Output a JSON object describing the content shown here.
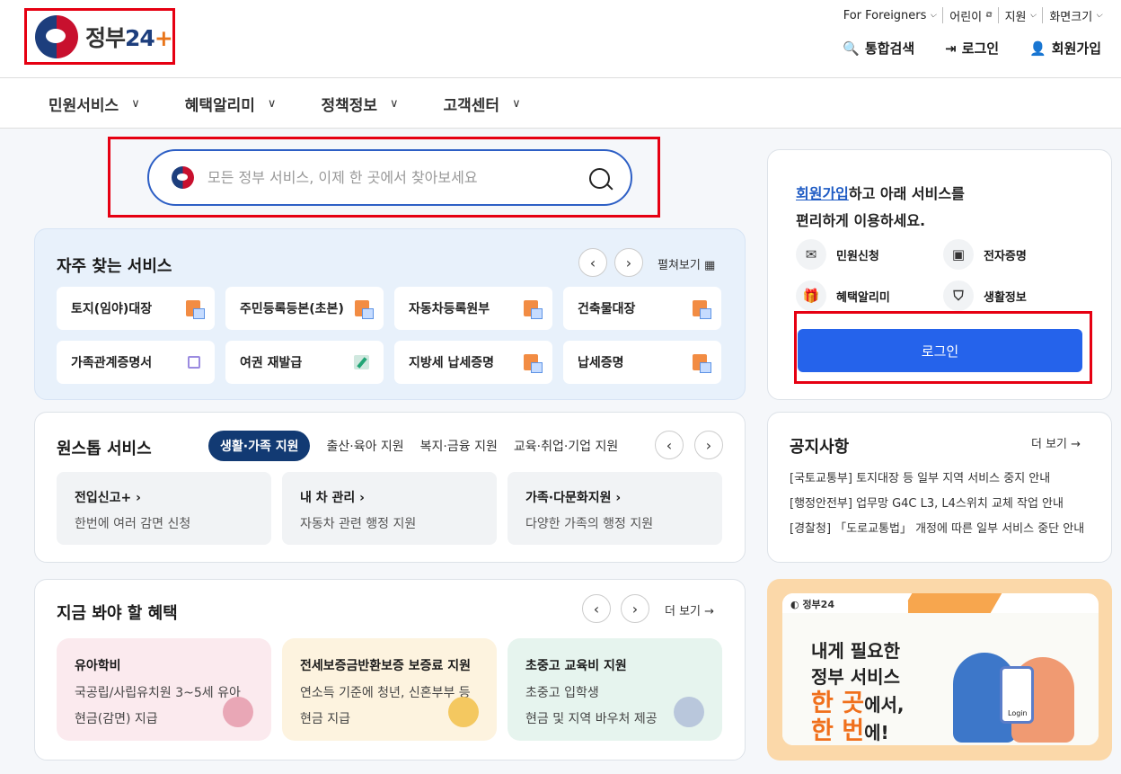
{
  "header": {
    "logo": {
      "text": "정부",
      "number": "24",
      "plus": "+"
    },
    "utility": {
      "foreigners": "For Foreigners",
      "kids": "어린이",
      "support": "지원",
      "screen_size": "화면크기"
    },
    "actions": {
      "search": "통합검색",
      "login": "로그인",
      "signup": "회원가입"
    }
  },
  "nav": {
    "items": [
      {
        "label": "민원서비스"
      },
      {
        "label": "혜택알리미"
      },
      {
        "label": "정책정보"
      },
      {
        "label": "고객센터"
      }
    ]
  },
  "search": {
    "placeholder": "모든 정부 서비스, 이제 한 곳에서 찾아보세요"
  },
  "frequent": {
    "title": "자주 찾는 서비스",
    "expand_label": "펼쳐보기",
    "items": [
      {
        "label": "토지(임야)대장",
        "icon": "document-icon"
      },
      {
        "label": "주민등록등본(초본)",
        "icon": "document-icon"
      },
      {
        "label": "자동차등록원부",
        "icon": "document-icon"
      },
      {
        "label": "건축물대장",
        "icon": "document-icon"
      },
      {
        "label": "가족관계증명서",
        "icon": "external-link-icon"
      },
      {
        "label": "여권 재발급",
        "icon": "edit-icon"
      },
      {
        "label": "지방세 납세증명",
        "icon": "document-icon"
      },
      {
        "label": "납세증명",
        "icon": "document-icon"
      }
    ]
  },
  "onestop": {
    "title": "원스톱 서비스",
    "tabs": [
      {
        "label": "생활·가족 지원",
        "active": true
      },
      {
        "label": "출산·육아 지원"
      },
      {
        "label": "복지·금융 지원"
      },
      {
        "label": "교육·취업·기업 지원"
      }
    ],
    "items": [
      {
        "title": "전입신고+",
        "desc": "한번에 여러 감면 신청"
      },
      {
        "title": "내 차 관리",
        "desc": "자동차 관련 행정 지원"
      },
      {
        "title": "가족·다문화지원",
        "desc": "다양한 가족의 행정 지원"
      }
    ]
  },
  "benefits": {
    "title": "지금 봐야 할 혜택",
    "more": "더 보기",
    "items": [
      {
        "title": "유아학비",
        "target": "국공립/사립유치원 3~5세 유아",
        "type": "현금(감면) 지급"
      },
      {
        "title": "전세보증금반환보증 보증료 지원",
        "target": "연소득 기준에 청년, 신혼부부 등",
        "type": "현금 지급"
      },
      {
        "title": "초중고 교육비 지원",
        "target": "초중고 입학생",
        "type": "현금 및 지역 바우처 제공"
      }
    ]
  },
  "signup_box": {
    "link": "회원가입",
    "line1_rest": "하고 아래 서비스를",
    "line2": "편리하게 이용하세요.",
    "features": [
      {
        "label": "민원신청",
        "icon": "mail-icon"
      },
      {
        "label": "전자증명",
        "icon": "certificate-icon"
      },
      {
        "label": "혜택알리미",
        "icon": "gift-icon"
      },
      {
        "label": "생활정보",
        "icon": "bookmark-icon"
      }
    ],
    "login_button": "로그인"
  },
  "notice": {
    "title": "공지사항",
    "more": "더 보기",
    "items": [
      "[국토교통부] 토지대장 등 일부 지역 서비스 중지 안내",
      "[행정안전부] 업무망 G4C L3, L4스위치 교체 작업 안내",
      "[경찰청] 「도로교통법」 개정에 따른 일부 서비스 중단 안내"
    ]
  },
  "banner": {
    "tab_label": "정부24",
    "line1": "내게 필요한",
    "line2": "정부 서비스",
    "line3_orange": "한 곳",
    "line3_rest": "에서,",
    "line4_orange": "한 번",
    "line4_rest": "에!",
    "phone_label": "Login"
  },
  "colors": {
    "brand_blue": "#2563eb",
    "navy": "#123a73",
    "highlight_red": "#e60012"
  }
}
